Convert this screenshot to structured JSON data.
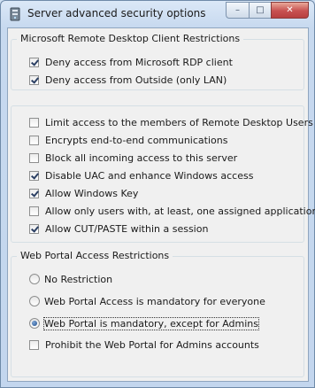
{
  "window": {
    "title": "Server advanced security options"
  },
  "caption": {
    "minimize": "–",
    "maximize": "□",
    "close": "✕"
  },
  "rdp_group": {
    "legend": "Microsoft Remote Desktop Client Restrictions",
    "items": [
      {
        "label": "Deny access from Microsoft RDP client",
        "checked": true
      },
      {
        "label": "Deny access from Outside (only LAN)",
        "checked": true
      }
    ]
  },
  "options_group": {
    "items": [
      {
        "label": "Limit access to the members of Remote Desktop Users",
        "checked": false
      },
      {
        "label": "Encrypts end-to-end communications",
        "checked": false
      },
      {
        "label": "Block all incoming access to this server",
        "checked": false
      },
      {
        "label": "Disable UAC and enhance Windows access",
        "checked": true
      },
      {
        "label": "Allow Windows Key",
        "checked": true
      },
      {
        "label": "Allow only users with, at least, one assigned application",
        "checked": false
      },
      {
        "label": "Allow CUT/PASTE within a session",
        "checked": true
      }
    ]
  },
  "portal_group": {
    "legend": "Web Portal Access Restrictions",
    "radios": [
      {
        "label": "No Restriction",
        "selected": false
      },
      {
        "label": "Web Portal Access is mandatory for everyone",
        "selected": false
      },
      {
        "label": "Web Portal is mandatory, except for Admins",
        "selected": true
      }
    ],
    "checkbox": {
      "label": "Prohibit the Web Portal for Admins accounts",
      "checked": false
    }
  }
}
